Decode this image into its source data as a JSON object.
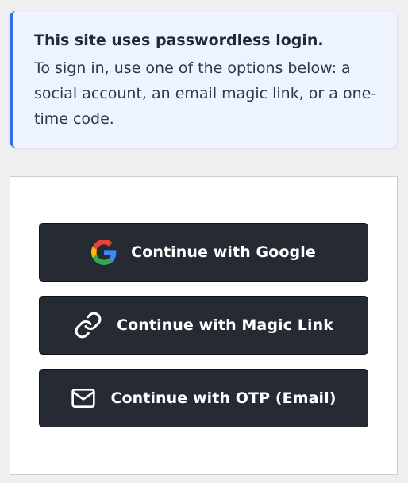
{
  "notice": {
    "title": "This site uses passwordless login.",
    "body": "To sign in, use one of the options below: a social account, an email magic link, or a one-time code.",
    "accent_color": "#2f6fed",
    "background_color": "#eef4ff"
  },
  "login_options": {
    "google": {
      "label": "Continue with Google",
      "icon": "google-logo-icon"
    },
    "magic_link": {
      "label": "Continue with Magic Link",
      "icon": "link-icon"
    },
    "otp": {
      "label": "Continue with OTP (Email)",
      "icon": "envelope-icon"
    },
    "button_color": "#252a33"
  }
}
